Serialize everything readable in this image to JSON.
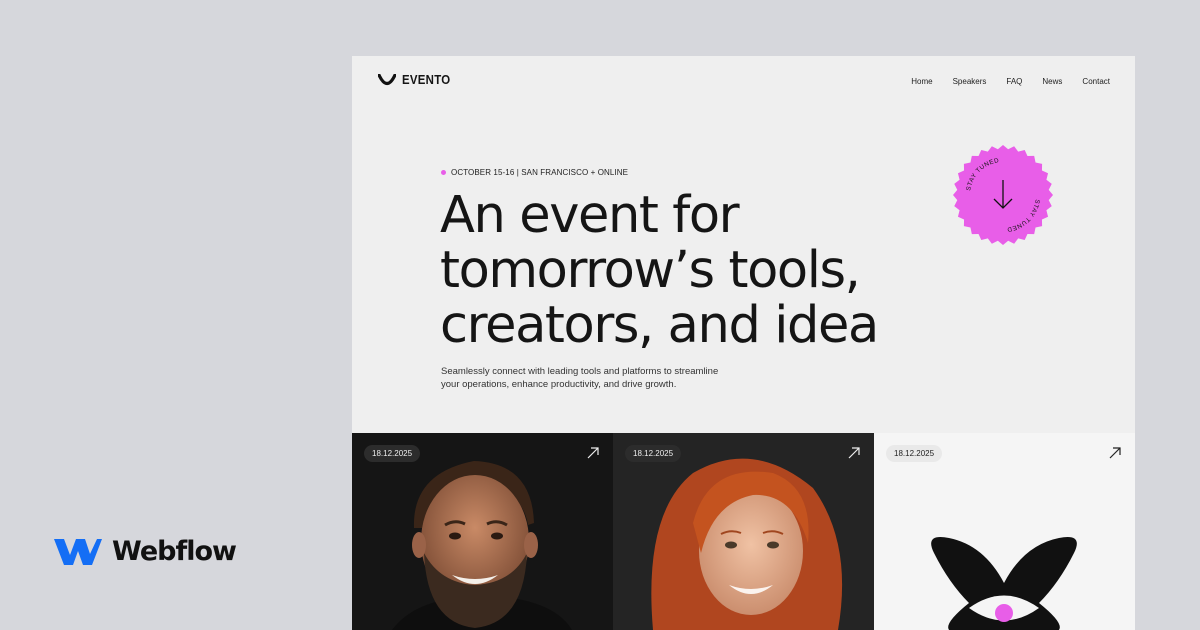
{
  "brand": {
    "name": "Webflow"
  },
  "site": {
    "logo_text": "EVENTO",
    "nav": [
      "Home",
      "Speakers",
      "FAQ",
      "News",
      "Contact"
    ]
  },
  "hero": {
    "eyebrow": "OCTOBER 15-16 | SAN FRANCISCO + ONLINE",
    "headline_lines": [
      "An event for",
      "tomorrow’s tools,",
      "creators, and idea"
    ],
    "subtext_lines": [
      "Seamlessly connect with leading tools and platforms to streamline",
      "your operations, enhance productivity, and drive growth."
    ],
    "badge_text": "STAY TUNED"
  },
  "cards": [
    {
      "date": "18.12.2025",
      "kind": "speaker-photo-man"
    },
    {
      "date": "18.12.2025",
      "kind": "speaker-photo-woman"
    },
    {
      "date": "18.12.2025",
      "kind": "logo-graphic"
    }
  ],
  "colors": {
    "accent": "#e85ee8",
    "brand_blue": "#146ef5"
  }
}
